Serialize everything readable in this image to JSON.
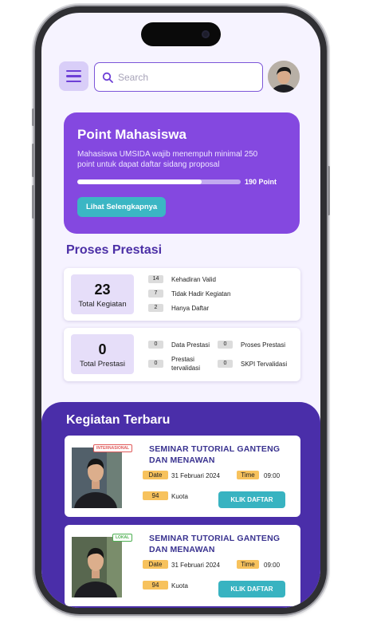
{
  "search": {
    "placeholder": "Search"
  },
  "point": {
    "title": "Point Mahasiswa",
    "description": "Mahasiswa UMSIDA wajib menempuh minimal 250 point untuk dapat daftar sidang proposal",
    "progress_fraction": 0.76,
    "progress_label": "190 Point",
    "button": "Lihat Selengkapnya"
  },
  "prestasi": {
    "title": "Proses Prestasi",
    "kegiatan_card": {
      "total": "23",
      "total_label": "Total Kegiatan",
      "rows": [
        {
          "count": "14",
          "label": "Kehadiran Valid"
        },
        {
          "count": "7",
          "label": "Tidak Hadir Kegiatan"
        },
        {
          "count": "2",
          "label": "Hanya Daftar"
        }
      ]
    },
    "prestasi_card": {
      "total": "0",
      "total_label": "Total Prestasi",
      "rows": [
        {
          "count": "0",
          "label": "Data Prestasi"
        },
        {
          "count": "0",
          "label": "Proses Prestasi"
        },
        {
          "count": "0",
          "label": "Prestasi tervalidasi"
        },
        {
          "count": "0",
          "label": "SKPI Tervalidasi"
        }
      ]
    }
  },
  "kegiatan": {
    "title": "Kegiatan Terbaru",
    "events": [
      {
        "tag": "INTERNASIONAL",
        "tag_color": "#e05a5a",
        "title": "SEMINAR  TUTORIAL GANTENG DAN MENAWAN",
        "date_label": "Date",
        "date": "31 Februari 2024",
        "time_label": "Time",
        "time": "09:00",
        "quota": "94",
        "quota_label": "Kuota",
        "button": "KLIK DAFTAR"
      },
      {
        "tag": "LOKAL",
        "tag_color": "#4caf50",
        "title": "SEMINAR  TUTORIAL GANTENG DAN MENAWAN",
        "date_label": "Date",
        "date": "31 Februari 2024",
        "time_label": "Time",
        "time": "09:00",
        "quota": "94",
        "quota_label": "Kuota",
        "button": "KLIK DAFTAR"
      }
    ]
  },
  "colors": {
    "primary": "#8448e0",
    "dark_primary": "#4a2ea9",
    "accent": "#3bb6c4",
    "tag_yellow": "#f7c25d"
  }
}
